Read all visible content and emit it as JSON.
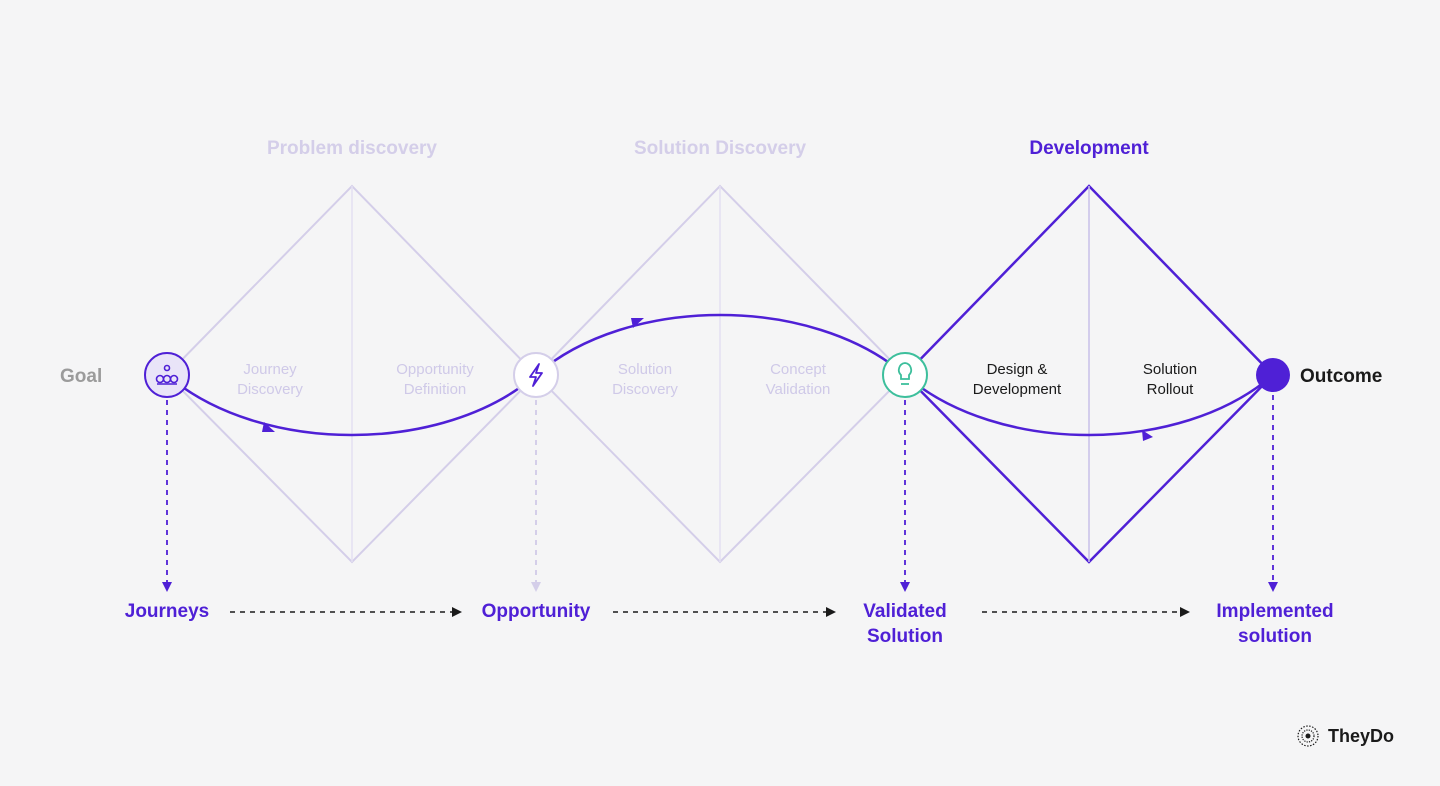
{
  "phases": {
    "problem_discovery": "Problem discovery",
    "solution_discovery": "Solution Discovery",
    "development": "Development"
  },
  "nodes": {
    "goal": "Goal",
    "outcome": "Outcome"
  },
  "inner_labels": {
    "journey_discovery": "Journey\nDiscovery",
    "opportunity_definition": "Opportunity\nDefinition",
    "solution_discovery": "Solution\nDiscovery",
    "concept_validation": "Concept\nValidation",
    "design_dev": "Design &\nDevelopment",
    "solution_rollout": "Solution\nRollout"
  },
  "outputs": {
    "journeys": "Journeys",
    "opportunity": "Opportunity",
    "validated_solution": "Validated\nSolution",
    "implemented_solution": "Implemented\nsolution"
  },
  "brand": "TheyDo",
  "colors": {
    "purple": "#4f20d6",
    "faded_purple": "#d4cee9",
    "teal": "#3dbf9c"
  }
}
